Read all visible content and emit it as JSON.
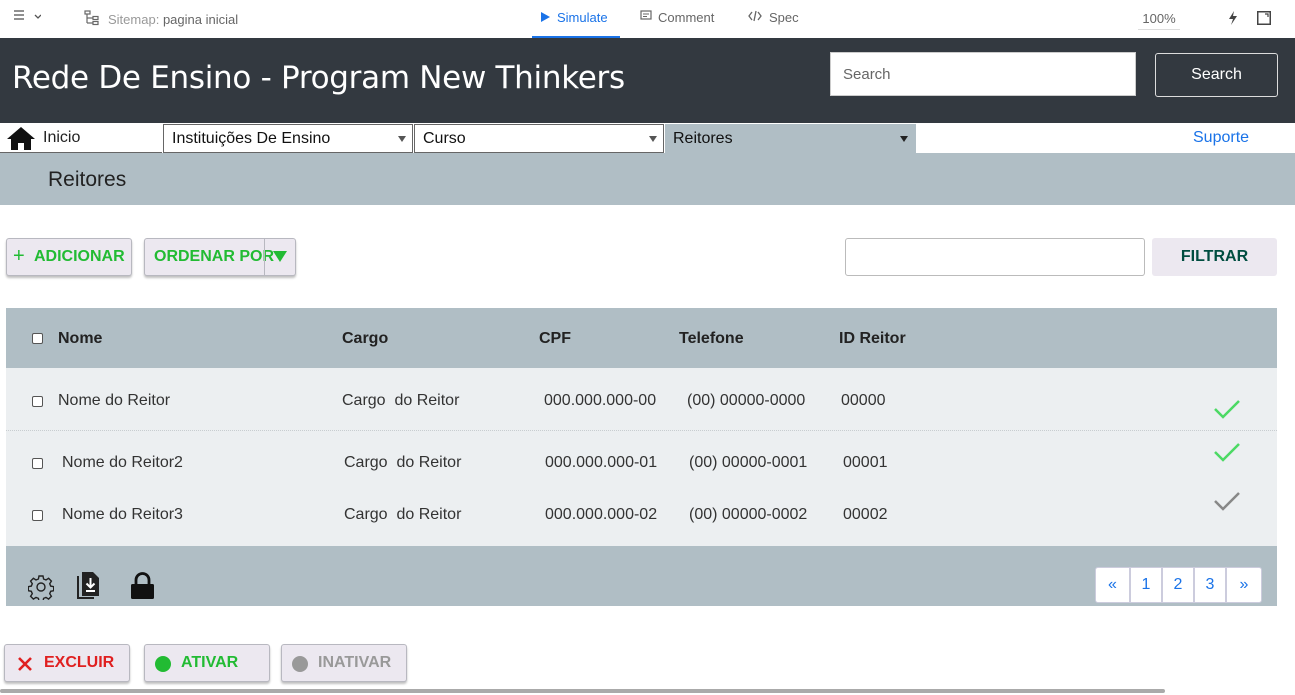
{
  "toolbar": {
    "sitemap_prefix": "Sitemap:",
    "sitemap_page": "pagina inicial",
    "tabs": [
      {
        "label": "Simulate",
        "active": true
      },
      {
        "label": "Comment",
        "active": false
      },
      {
        "label": "Spec",
        "active": false
      }
    ],
    "zoom": "100%"
  },
  "header": {
    "title": "Rede De Ensino - Program New Thinkers",
    "search_placeholder": "Search",
    "search_button": "Search"
  },
  "nav": {
    "home_label": "Inicio",
    "items": [
      {
        "label": "Instituições De Ensino"
      },
      {
        "label": "Curso"
      },
      {
        "label": "Reitores"
      }
    ],
    "support_link": "Suporte"
  },
  "page": {
    "title": "Reitores"
  },
  "actions": {
    "add_label": "ADICIONAR",
    "order_label": "ORDENAR POR",
    "filter_value": "",
    "filter_label": "FILTRAR"
  },
  "table": {
    "columns": [
      "Nome",
      "Cargo",
      "CPF",
      "Telefone",
      "ID Reitor"
    ],
    "rows": [
      {
        "nome": "Nome do Reitor",
        "cargo": "Cargo  do Reitor",
        "cpf": "000.000.000-00",
        "telefone": "(00) 00000-0000",
        "id": "00000",
        "status": "active"
      },
      {
        "nome": "Nome do Reitor2",
        "cargo": "Cargo  do Reitor",
        "cpf": "000.000.000-01",
        "telefone": "(00) 00000-0001",
        "id": "00001",
        "status": "active"
      },
      {
        "nome": "Nome do Reitor3",
        "cargo": "Cargo  do Reitor",
        "cpf": "000.000.000-02",
        "telefone": "(00) 00000-0002",
        "id": "00002",
        "status": "inactive"
      }
    ]
  },
  "pagination": {
    "prev": "«",
    "pages": [
      "1",
      "2",
      "3"
    ],
    "next": "»"
  },
  "footer_icons": [
    "gear-icon",
    "download-icon",
    "lock-icon"
  ],
  "bottom_actions": {
    "delete_label": "EXCLUIR",
    "activate_label": "ATIVAR",
    "deactivate_label": "INATIVAR"
  },
  "colors": {
    "header_bg": "#333940",
    "subheader_bg": "#b0bec5",
    "accent_blue": "#1a73e8",
    "green": "#22bb33",
    "red": "#e02020",
    "check_active": "#4cd964",
    "check_inactive": "#888888"
  }
}
